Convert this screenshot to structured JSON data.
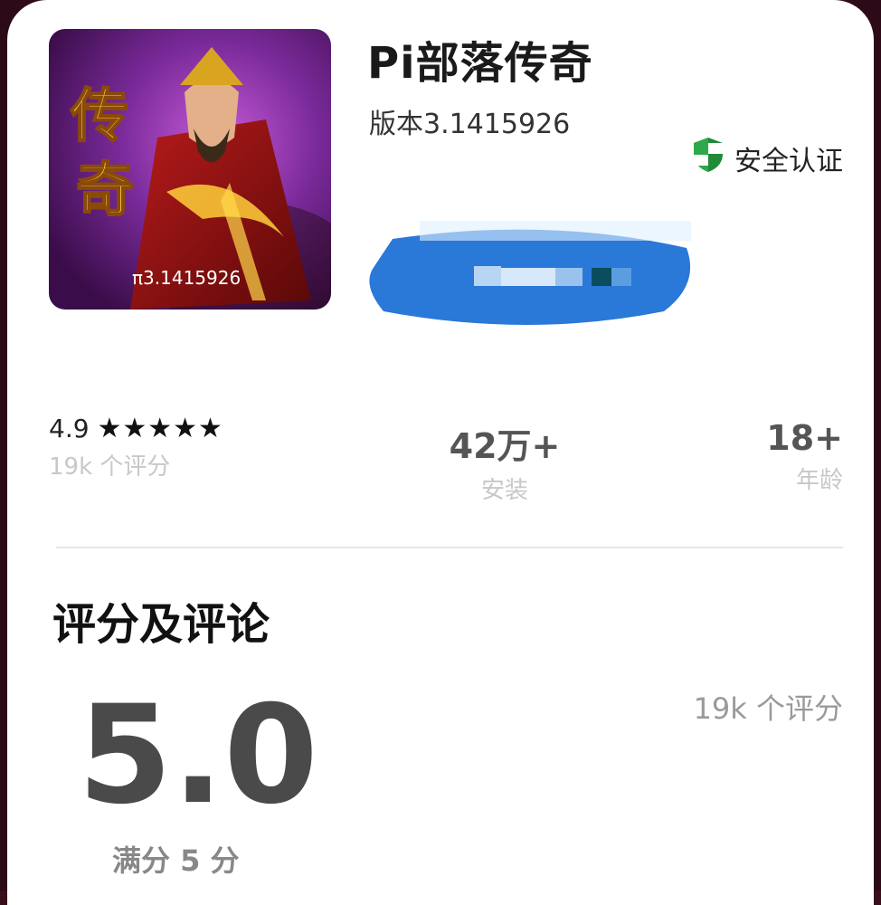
{
  "app": {
    "title": "Pi部落传奇",
    "version": "版本3.1415926",
    "icon_text_main": "传奇",
    "icon_text_sub": "π3.1415926",
    "security_label": "安全认证"
  },
  "stats": {
    "rating": "4.9",
    "stars": "★★★★★",
    "rating_count": "19k 个评分",
    "installs": "42万+",
    "installs_label": "安装",
    "age": "18+",
    "age_label": "年龄"
  },
  "reviews": {
    "section_title": "评分及评论",
    "score": "5.0",
    "full_score": "满分 5 分",
    "count": "19k 个评分"
  },
  "colors": {
    "shield_green": "#1f8a3a",
    "blur_blue": "#2a78d8"
  },
  "icons": [
    "shield-check-icon"
  ]
}
